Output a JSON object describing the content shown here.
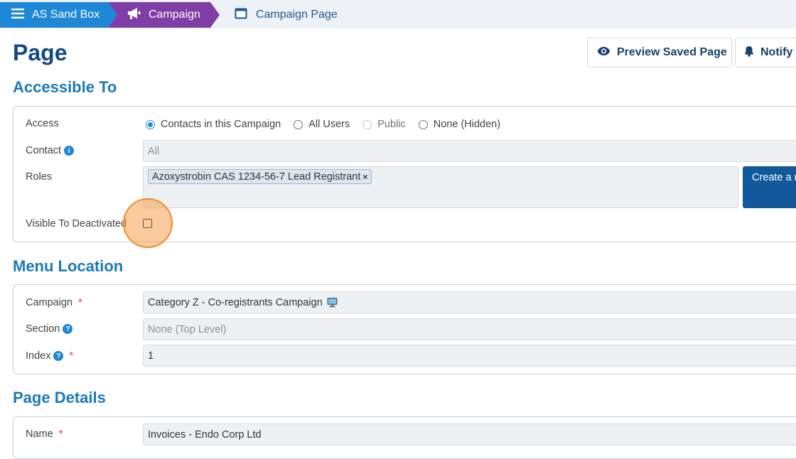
{
  "breadcrumb": {
    "home": "AS Sand Box",
    "campaign": "Campaign",
    "page": "Campaign Page"
  },
  "page_title": "Page",
  "header_buttons": {
    "preview": "Preview Saved Page",
    "notify": "Notify C"
  },
  "accessible_to": {
    "heading": "Accessible To",
    "access_label": "Access",
    "access_options": [
      {
        "label": "Contacts in this Campaign",
        "checked": true,
        "disabled": false
      },
      {
        "label": "All Users",
        "checked": false,
        "disabled": false
      },
      {
        "label": "Public",
        "checked": false,
        "disabled": true
      },
      {
        "label": "None (Hidden)",
        "checked": false,
        "disabled": false
      }
    ],
    "contact_label": "Contact",
    "contact_value": "All",
    "roles_label": "Roles",
    "roles_tags": [
      "Azoxystrobin CAS 1234-56-7 Lead Registrant"
    ],
    "tag_remove": "×",
    "create_button": "Create a new role",
    "visible_deactivated_label": "Visible To Deactivated",
    "visible_deactivated_checked": false
  },
  "menu_location": {
    "heading": "Menu Location",
    "campaign_label": "Campaign",
    "campaign_value": "Category Z - Co-registrants Campaign",
    "section_label": "Section",
    "section_value": "None (Top Level)",
    "index_label": "Index",
    "index_value": "1",
    "required_mark": "*"
  },
  "page_details": {
    "heading": "Page Details",
    "name_label": "Name",
    "name_value": "Invoices - Endo Corp Ltd"
  },
  "colors": {
    "home_crumb": "#1e88d6",
    "campaign_crumb": "#7e3ea6",
    "title": "#124a7d",
    "section_heading": "#1a7ab8",
    "primary_button": "#12599c",
    "highlight": "#f79e4c"
  }
}
